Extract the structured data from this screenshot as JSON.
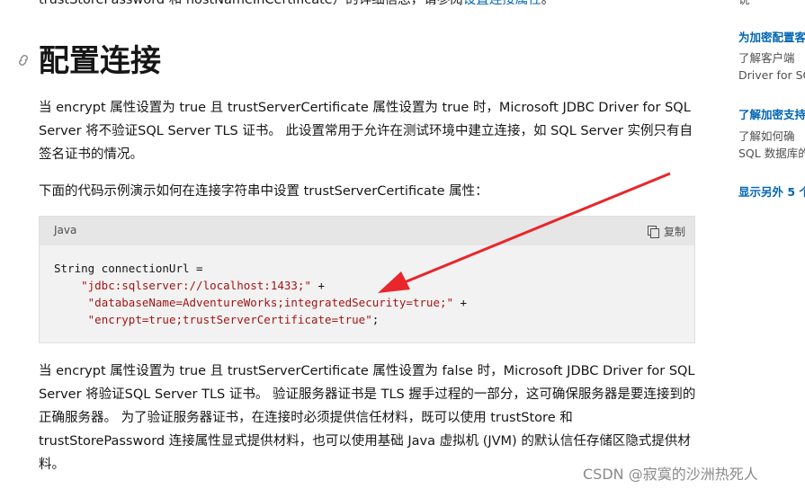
{
  "intro": {
    "prefix": "trustStorePassword 和 hostNameInCertificate）的详细信息，请参阅",
    "link": "设置连接属性",
    "suffix": "。"
  },
  "section": {
    "title": "配置连接",
    "para1": "当 encrypt 属性设置为 true 且 trustServerCertificate 属性设置为 true 时，Microsoft JDBC Driver for SQL Server 将不验证SQL Server TLS 证书。 此设置常用于允许在测试环境中建立连接，如 SQL Server 实例只有自签名证书的情况。",
    "para2": "下面的代码示例演示如何在连接字符串中设置 trustServerCertificate 属性：",
    "para3": "当 encrypt 属性设置为 true 且 trustServerCertificate 属性设置为 false 时，Microsoft JDBC Driver for SQL Server 将验证SQL Server TLS 证书。 验证服务器证书是 TLS 握手过程的一部分，这可确保服务器是要连接到的正确服务器。 为了验证服务器证书，在连接时必须提供信任材料，既可以使用 trustStore 和 trustStorePassword 连接属性显式提供材料，也可以使用基础 Java 虚拟机 (JVM) 的默认信任存储区隐式提供材料。"
  },
  "code": {
    "language": "Java",
    "copy_label": "复制",
    "line1": "String connectionUrl =",
    "line2_indent": "    ",
    "line2_str": "\"jdbc:sqlserver://localhost:1433;\"",
    "line2_op": " +",
    "line3_indent": "     ",
    "line3_str": "\"databaseName=AdventureWorks;integratedSecurity=true;\"",
    "line3_op": " +",
    "line4_indent": "     ",
    "line4_str": "\"encrypt=true;trustServerCertificate=true\"",
    "line4_op": ";"
  },
  "sidebar": {
    "top_fragment": "说",
    "link1": "为加密配置客",
    "link1_desc1": "了解客户端",
    "link1_desc2": "Driver for SQ",
    "link2": "了解加密支持",
    "link2_desc1": "了解如何确",
    "link2_desc2": "SQL 数据库的",
    "more": "显示另外 5 个"
  },
  "watermark": "CSDN @寂寞的沙洲热死人",
  "colors": {
    "link": "#0065b3",
    "arrow": "#e8262b",
    "string": "#a31515"
  }
}
